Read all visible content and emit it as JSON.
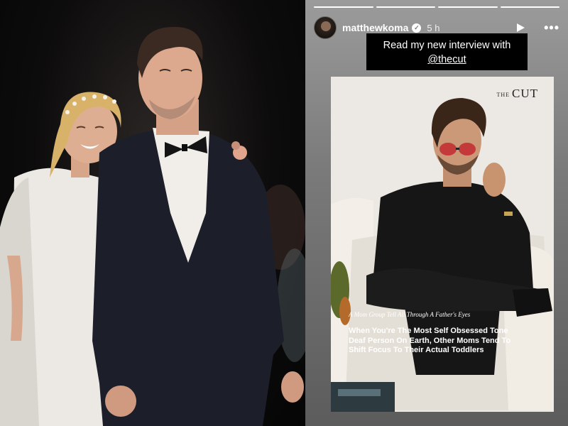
{
  "story": {
    "progress_segments": 4,
    "active_segment": 4,
    "username": "matthewkoma",
    "verified_icon": "verified-badge-icon",
    "time_ago": "5 h",
    "caption_line1": "Read my new interview with",
    "caption_line2": "@thecut"
  },
  "article": {
    "logo_small": "THE",
    "logo_main": "CUT",
    "kicker": "A Mom Group Tell All Through A Father's Eyes",
    "headline": "When You're The Most Self Obsessed Tone Deaf Person On Earth, Other Moms Tend To Shift Focus To Their Actual Toddlers"
  },
  "colors": {
    "photo_background": "#0d0c0c",
    "story_gradient_top": "#9b9b9b",
    "caption_box": "#000000",
    "article_background": "#e9e6e1"
  }
}
